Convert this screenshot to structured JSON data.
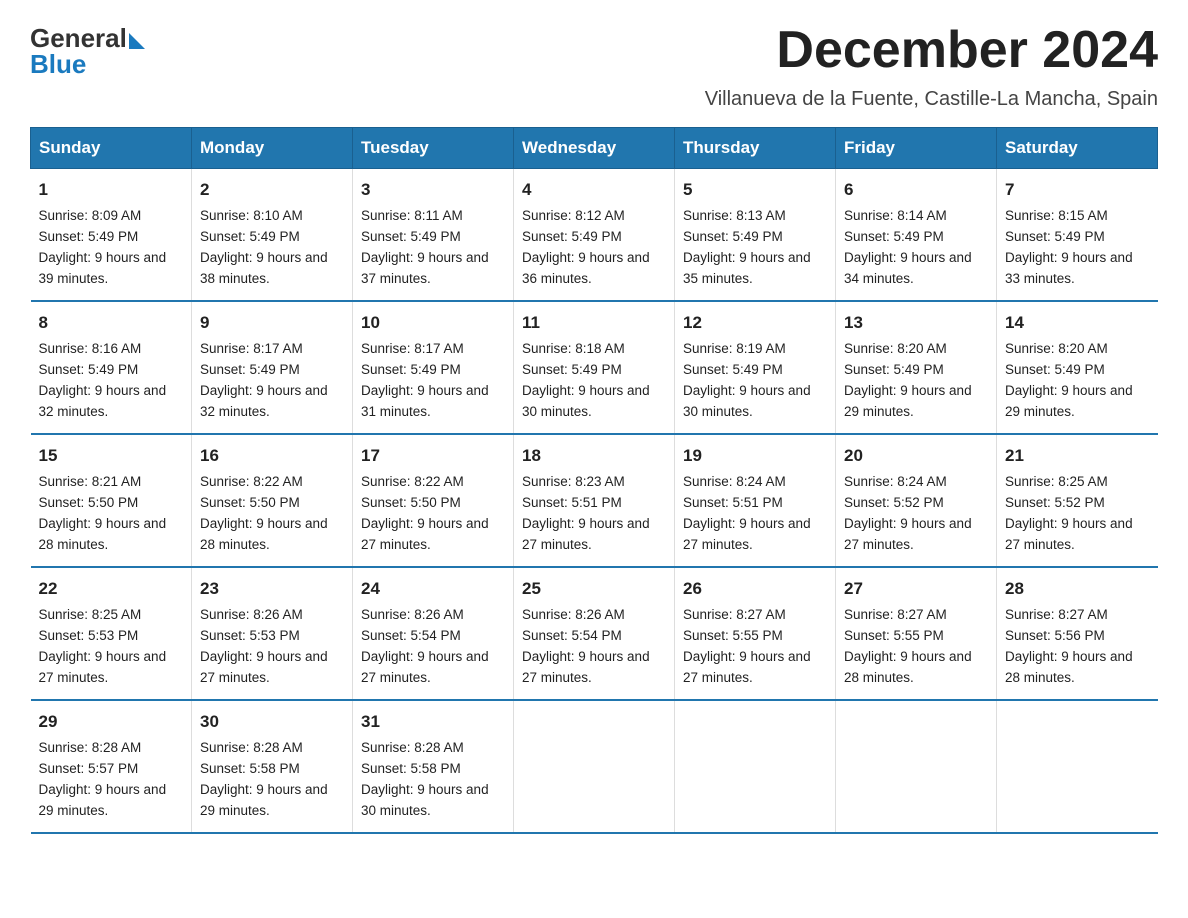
{
  "logo": {
    "text_general": "General",
    "text_blue": "Blue"
  },
  "title": "December 2024",
  "subtitle": "Villanueva de la Fuente, Castille-La Mancha, Spain",
  "days_of_week": [
    "Sunday",
    "Monday",
    "Tuesday",
    "Wednesday",
    "Thursday",
    "Friday",
    "Saturday"
  ],
  "weeks": [
    [
      {
        "day": "1",
        "sunrise": "8:09 AM",
        "sunset": "5:49 PM",
        "daylight": "9 hours and 39 minutes."
      },
      {
        "day": "2",
        "sunrise": "8:10 AM",
        "sunset": "5:49 PM",
        "daylight": "9 hours and 38 minutes."
      },
      {
        "day": "3",
        "sunrise": "8:11 AM",
        "sunset": "5:49 PM",
        "daylight": "9 hours and 37 minutes."
      },
      {
        "day": "4",
        "sunrise": "8:12 AM",
        "sunset": "5:49 PM",
        "daylight": "9 hours and 36 minutes."
      },
      {
        "day": "5",
        "sunrise": "8:13 AM",
        "sunset": "5:49 PM",
        "daylight": "9 hours and 35 minutes."
      },
      {
        "day": "6",
        "sunrise": "8:14 AM",
        "sunset": "5:49 PM",
        "daylight": "9 hours and 34 minutes."
      },
      {
        "day": "7",
        "sunrise": "8:15 AM",
        "sunset": "5:49 PM",
        "daylight": "9 hours and 33 minutes."
      }
    ],
    [
      {
        "day": "8",
        "sunrise": "8:16 AM",
        "sunset": "5:49 PM",
        "daylight": "9 hours and 32 minutes."
      },
      {
        "day": "9",
        "sunrise": "8:17 AM",
        "sunset": "5:49 PM",
        "daylight": "9 hours and 32 minutes."
      },
      {
        "day": "10",
        "sunrise": "8:17 AM",
        "sunset": "5:49 PM",
        "daylight": "9 hours and 31 minutes."
      },
      {
        "day": "11",
        "sunrise": "8:18 AM",
        "sunset": "5:49 PM",
        "daylight": "9 hours and 30 minutes."
      },
      {
        "day": "12",
        "sunrise": "8:19 AM",
        "sunset": "5:49 PM",
        "daylight": "9 hours and 30 minutes."
      },
      {
        "day": "13",
        "sunrise": "8:20 AM",
        "sunset": "5:49 PM",
        "daylight": "9 hours and 29 minutes."
      },
      {
        "day": "14",
        "sunrise": "8:20 AM",
        "sunset": "5:49 PM",
        "daylight": "9 hours and 29 minutes."
      }
    ],
    [
      {
        "day": "15",
        "sunrise": "8:21 AM",
        "sunset": "5:50 PM",
        "daylight": "9 hours and 28 minutes."
      },
      {
        "day": "16",
        "sunrise": "8:22 AM",
        "sunset": "5:50 PM",
        "daylight": "9 hours and 28 minutes."
      },
      {
        "day": "17",
        "sunrise": "8:22 AM",
        "sunset": "5:50 PM",
        "daylight": "9 hours and 27 minutes."
      },
      {
        "day": "18",
        "sunrise": "8:23 AM",
        "sunset": "5:51 PM",
        "daylight": "9 hours and 27 minutes."
      },
      {
        "day": "19",
        "sunrise": "8:24 AM",
        "sunset": "5:51 PM",
        "daylight": "9 hours and 27 minutes."
      },
      {
        "day": "20",
        "sunrise": "8:24 AM",
        "sunset": "5:52 PM",
        "daylight": "9 hours and 27 minutes."
      },
      {
        "day": "21",
        "sunrise": "8:25 AM",
        "sunset": "5:52 PM",
        "daylight": "9 hours and 27 minutes."
      }
    ],
    [
      {
        "day": "22",
        "sunrise": "8:25 AM",
        "sunset": "5:53 PM",
        "daylight": "9 hours and 27 minutes."
      },
      {
        "day": "23",
        "sunrise": "8:26 AM",
        "sunset": "5:53 PM",
        "daylight": "9 hours and 27 minutes."
      },
      {
        "day": "24",
        "sunrise": "8:26 AM",
        "sunset": "5:54 PM",
        "daylight": "9 hours and 27 minutes."
      },
      {
        "day": "25",
        "sunrise": "8:26 AM",
        "sunset": "5:54 PM",
        "daylight": "9 hours and 27 minutes."
      },
      {
        "day": "26",
        "sunrise": "8:27 AM",
        "sunset": "5:55 PM",
        "daylight": "9 hours and 27 minutes."
      },
      {
        "day": "27",
        "sunrise": "8:27 AM",
        "sunset": "5:55 PM",
        "daylight": "9 hours and 28 minutes."
      },
      {
        "day": "28",
        "sunrise": "8:27 AM",
        "sunset": "5:56 PM",
        "daylight": "9 hours and 28 minutes."
      }
    ],
    [
      {
        "day": "29",
        "sunrise": "8:28 AM",
        "sunset": "5:57 PM",
        "daylight": "9 hours and 29 minutes."
      },
      {
        "day": "30",
        "sunrise": "8:28 AM",
        "sunset": "5:58 PM",
        "daylight": "9 hours and 29 minutes."
      },
      {
        "day": "31",
        "sunrise": "8:28 AM",
        "sunset": "5:58 PM",
        "daylight": "9 hours and 30 minutes."
      },
      null,
      null,
      null,
      null
    ]
  ],
  "labels": {
    "sunrise": "Sunrise: ",
    "sunset": "Sunset: ",
    "daylight": "Daylight: "
  }
}
